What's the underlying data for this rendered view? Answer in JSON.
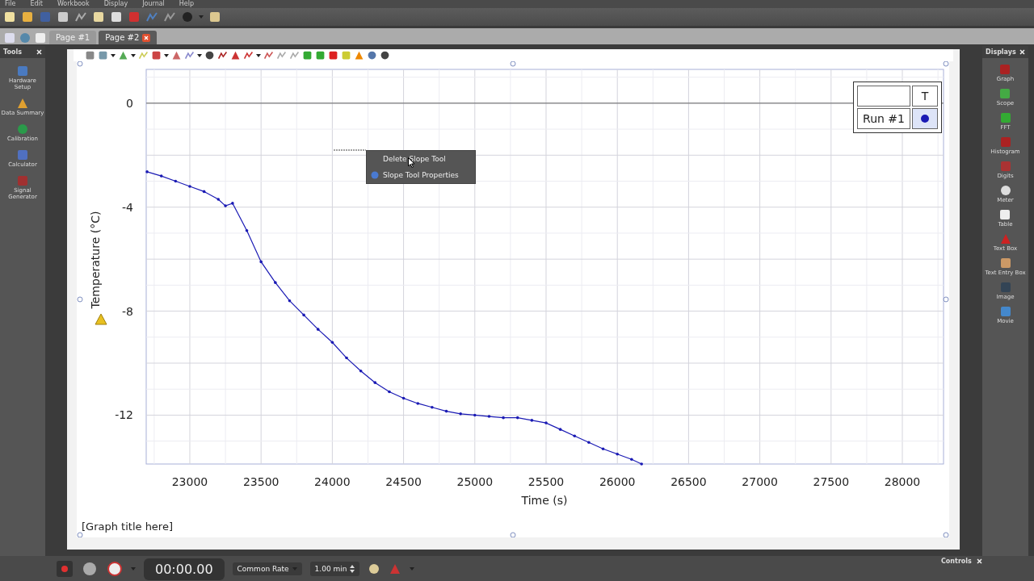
{
  "menu": [
    "File",
    "Edit",
    "Workbook",
    "Display",
    "Journal",
    "Help"
  ],
  "tabs": [
    {
      "label": "Page #1",
      "selected": false
    },
    {
      "label": "Page #2",
      "selected": true
    }
  ],
  "tools_panel": {
    "title": "Tools",
    "items": [
      "Hardware Setup",
      "Data Summary",
      "Calibration",
      "Calculator",
      "Signal Generator"
    ]
  },
  "displays_panel": {
    "title": "Displays",
    "items": [
      "Graph",
      "Scope",
      "FFT",
      "Histogram",
      "Digits",
      "Meter",
      "Table",
      "Text Box",
      "Text Entry Box",
      "Image",
      "Movie"
    ]
  },
  "graph": {
    "legend": {
      "header": "T"
    },
    "context_menu": [
      "Delete Slope Tool",
      "Slope Tool Properties"
    ],
    "chart_data": {
      "type": "line",
      "grid": true,
      "title": "[Graph title here]",
      "xlabel": "Time (s)",
      "ylabel": "Temperature (°C)",
      "x": [
        22700,
        22800,
        22900,
        23000,
        23100,
        23200,
        23250,
        23300,
        23400,
        23500,
        23600,
        23700,
        23800,
        23900,
        24000,
        24100,
        24200,
        24300,
        24400,
        24500,
        24600,
        24700,
        24800,
        24900,
        25000,
        25100,
        25200,
        25300,
        25400,
        25500,
        25600,
        25700,
        25800,
        25900,
        26000,
        26100,
        26170
      ],
      "series": [
        {
          "name": "Run #1",
          "color": "#1a1ab4",
          "values": [
            -2.64,
            -2.8,
            -3.0,
            -3.2,
            -3.4,
            -3.7,
            -3.95,
            -3.85,
            -4.9,
            -6.1,
            -6.9,
            -7.6,
            -8.15,
            -8.7,
            -9.2,
            -9.8,
            -10.3,
            -10.75,
            -11.1,
            -11.35,
            -11.55,
            -11.7,
            -11.85,
            -11.95,
            -12.0,
            -12.05,
            -12.1,
            -12.1,
            -12.2,
            -12.3,
            -12.55,
            -12.8,
            -13.05,
            -13.3,
            -13.5,
            -13.7,
            -13.88
          ]
        }
      ],
      "xlim": [
        22694,
        28289
      ],
      "ylim": [
        -13.88,
        1.3
      ],
      "xticks": [
        23000,
        23500,
        24000,
        24500,
        25000,
        25500,
        26000,
        26500,
        27000,
        27500,
        28000
      ],
      "yticks": [
        0,
        -4,
        -8,
        -12
      ]
    }
  },
  "controls": {
    "title": "Controls",
    "timer": "00:00.00",
    "rate_mode": "Common Rate",
    "rate_value": "1.00 min"
  }
}
